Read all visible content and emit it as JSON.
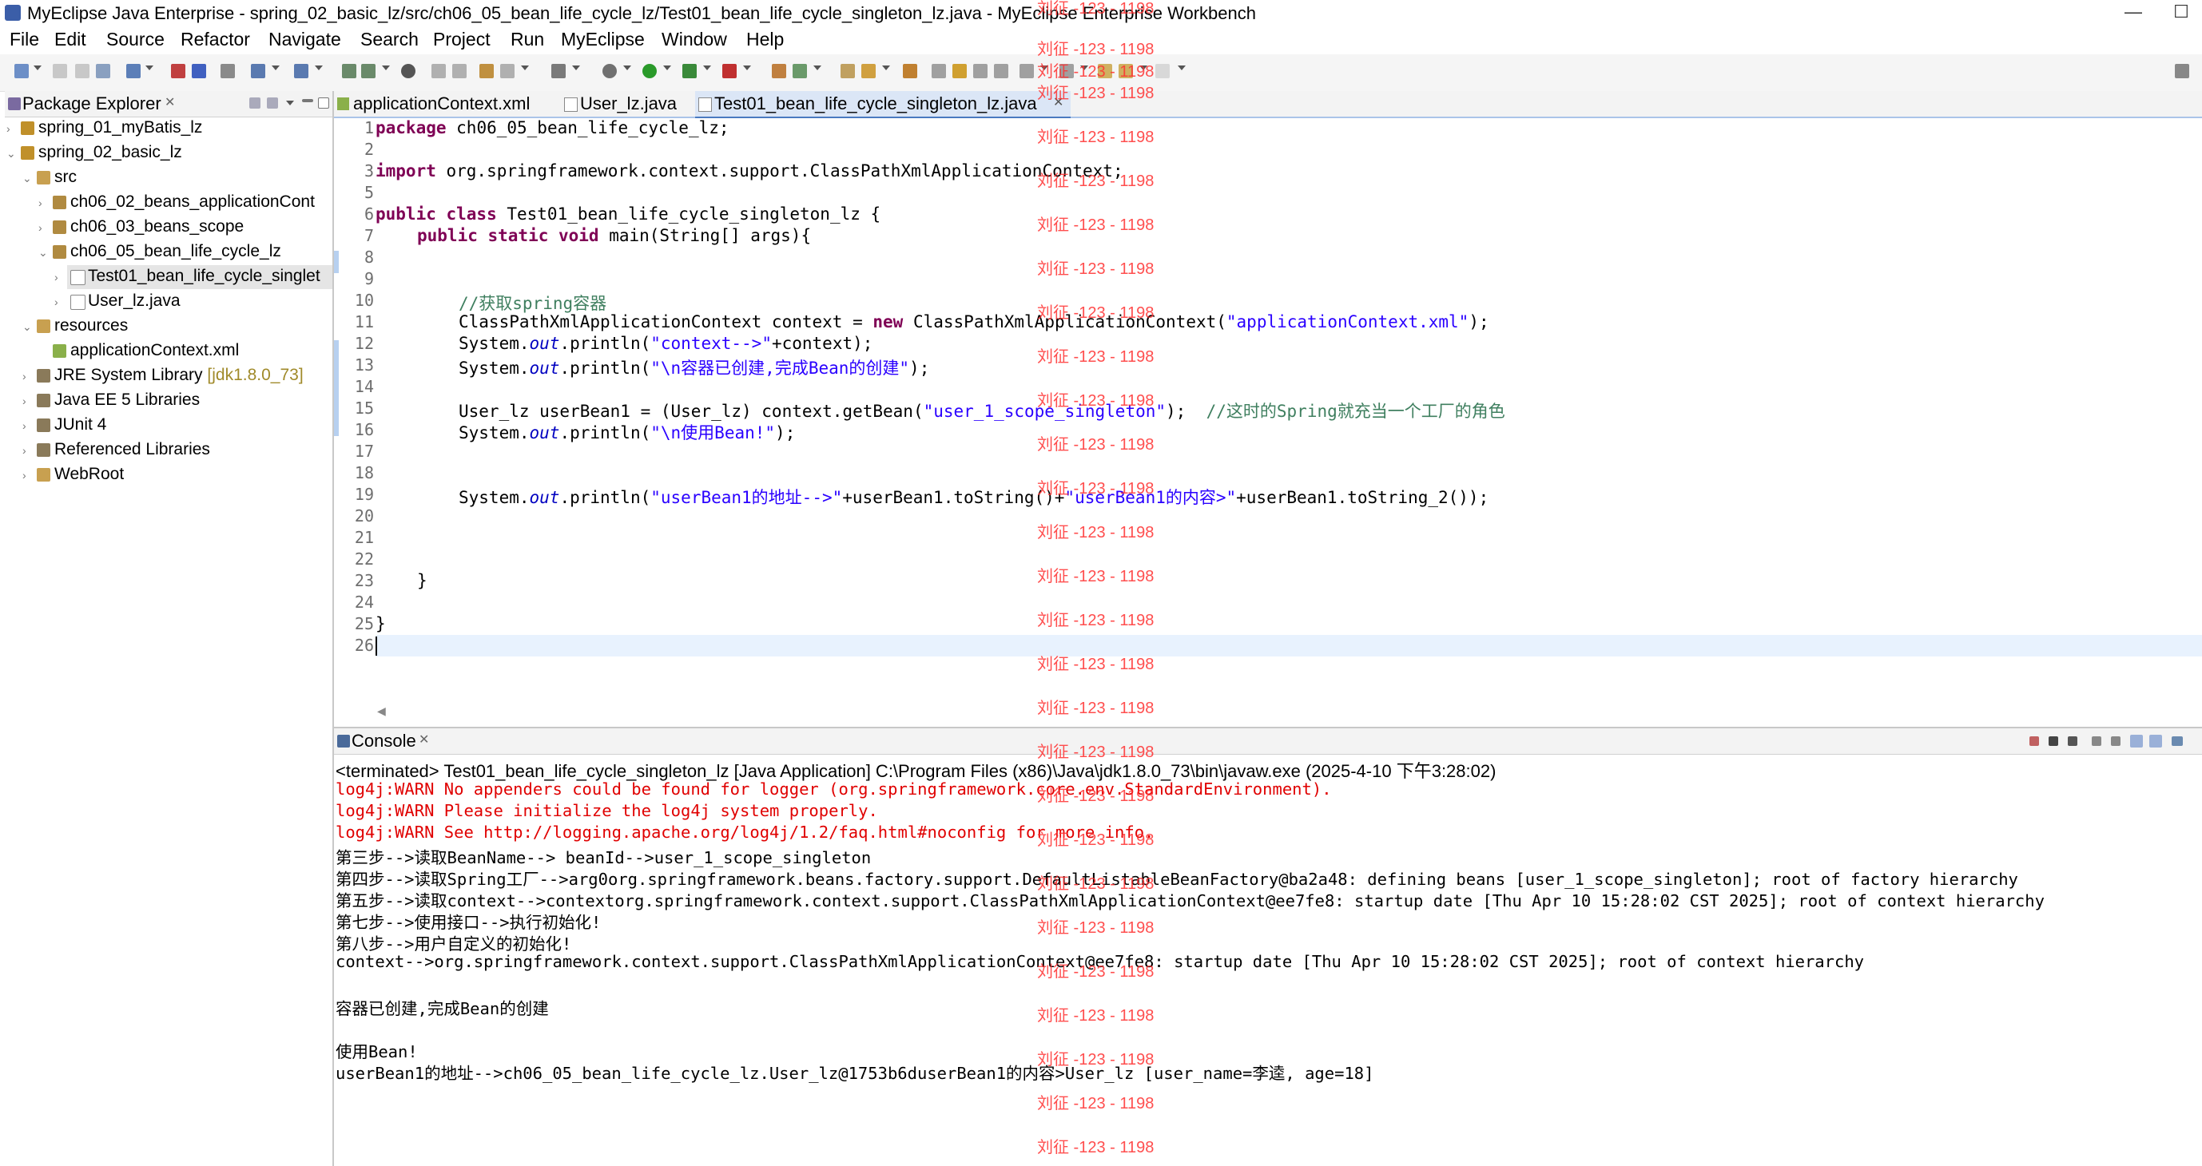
{
  "window": {
    "title": "MyEclipse Java Enterprise - spring_02_basic_lz/src/ch06_05_bean_life_cycle_lz/Test01_bean_life_cycle_singleton_lz.java - MyEclipse Enterprise Workbench",
    "minimize": "—",
    "maximize": "☐"
  },
  "menu": [
    "File",
    "Edit",
    "Source",
    "Refactor",
    "Navigate",
    "Search",
    "Project",
    "Run",
    "MyEclipse",
    "Window",
    "Help"
  ],
  "package_explorer": {
    "title": "Package Explorer",
    "items": [
      {
        "label": "spring_01_myBatis_lz",
        "decoration": ""
      },
      {
        "label": "spring_02_basic_lz",
        "decoration": ""
      },
      {
        "label": "src",
        "decoration": ""
      },
      {
        "label": "ch06_02_beans_applicationCont",
        "decoration": ""
      },
      {
        "label": "ch06_03_beans_scope",
        "decoration": ""
      },
      {
        "label": "ch06_05_bean_life_cycle_lz",
        "decoration": ""
      },
      {
        "label": "Test01_bean_life_cycle_singlet",
        "decoration": ""
      },
      {
        "label": "User_lz.java",
        "decoration": ""
      },
      {
        "label": "resources",
        "decoration": ""
      },
      {
        "label": "applicationContext.xml",
        "decoration": ""
      },
      {
        "label": "JRE System Library",
        "decoration": "[jdk1.8.0_73]"
      },
      {
        "label": "Java EE 5 Libraries",
        "decoration": ""
      },
      {
        "label": "JUnit 4",
        "decoration": ""
      },
      {
        "label": "Referenced Libraries",
        "decoration": ""
      },
      {
        "label": "WebRoot",
        "decoration": ""
      }
    ]
  },
  "editor": {
    "tabs": [
      "applicationContext.xml",
      "User_lz.java",
      "Test01_bean_life_cycle_singleton_lz.java"
    ],
    "active_tab": "Test01_bean_life_cycle_singleton_lz.java",
    "line_numbers": [
      "1",
      "2",
      "3",
      "5",
      "6",
      "7",
      "8",
      "9",
      "10",
      "11",
      "12",
      "13",
      "14",
      "15",
      "16",
      "17",
      "18",
      "19",
      "20",
      "21",
      "22",
      "23",
      "24",
      "25",
      "26"
    ],
    "code": {
      "l1_kw": "package",
      "l1_rest": " ch06_05_bean_life_cycle_lz;",
      "l3_kw": "import",
      "l3_rest": " org.springframework.context.support.ClassPathXmlApplicationContext;",
      "l6_kw": "public class",
      "l6_rest": " Test01_bean_life_cycle_singleton_lz {",
      "l7_kw": "public static void",
      "l7_rest": " main(String[] args){",
      "l10_cmt": "//获取spring容器",
      "l11_a": "ClassPathXmlApplicationContext context = ",
      "l11_kw": "new",
      "l11_b": " ClassPathXmlApplicationContext(",
      "l11_str": "\"applicationContext.xml\"",
      "l11_c": ");",
      "l12_a": "System.",
      "l12_fld": "out",
      "l12_b": ".println(",
      "l12_str": "\"context-->\"",
      "l12_c": "+context);",
      "l13_a": "System.",
      "l13_fld": "out",
      "l13_b": ".println(",
      "l13_str": "\"\\n容器已创建,完成Bean的创建\"",
      "l13_c": ");",
      "l15_a": "User_lz userBean1 = (User_lz) context.getBean(",
      "l15_str": "\"user_1_scope_singleton\"",
      "l15_b": ");  ",
      "l15_cmt": "//这时的Spring就充当一个工厂的角色",
      "l16_a": "System.",
      "l16_fld": "out",
      "l16_b": ".println(",
      "l16_str": "\"\\n使用Bean!\"",
      "l16_c": ");",
      "l19_a": "System.",
      "l19_fld": "out",
      "l19_b": ".println(",
      "l19_str1": "\"userBean1的地址-->\"",
      "l19_c": "+userBean1.toString()+",
      "l19_str2": "\"userBean1的内容>\"",
      "l19_d": "+userBean1.toString_2());",
      "l23": "}",
      "l25": "}"
    }
  },
  "console": {
    "title": "Console",
    "status": "<terminated> Test01_bean_life_cycle_singleton_lz [Java Application] C:\\Program Files (x86)\\Java\\jdk1.8.0_73\\bin\\javaw.exe (2025-4-10 下午3:28:02)",
    "lines": [
      {
        "text": "log4j:WARN No appenders could be found for logger (org.springframework.core.env.StandardEnvironment).",
        "kind": "err"
      },
      {
        "text": "log4j:WARN Please initialize the log4j system properly.",
        "kind": "err"
      },
      {
        "text": "log4j:WARN See http://logging.apache.org/log4j/1.2/faq.html#noconfig for more info.",
        "kind": "err"
      },
      {
        "text": "第三步-->读取BeanName--> beanId-->user_1_scope_singleton",
        "kind": "out"
      },
      {
        "text": "第四步-->读取Spring工厂-->arg0org.springframework.beans.factory.support.DefaultListableBeanFactory@ba2a48: defining beans [user_1_scope_singleton]; root of factory hierarchy",
        "kind": "out"
      },
      {
        "text": "第五步-->读取context-->contextorg.springframework.context.support.ClassPathXmlApplicationContext@ee7fe8: startup date [Thu Apr 10 15:28:02 CST 2025]; root of context hierarchy",
        "kind": "out"
      },
      {
        "text": "第七步-->使用接口-->执行初始化!",
        "kind": "out"
      },
      {
        "text": "第八步-->用户自定义的初始化!",
        "kind": "out"
      },
      {
        "text": "context-->org.springframework.context.support.ClassPathXmlApplicationContext@ee7fe8: startup date [Thu Apr 10 15:28:02 CST 2025]; root of context hierarchy",
        "kind": "out"
      },
      {
        "text": "",
        "kind": "out"
      },
      {
        "text": "容器已创建,完成Bean的创建",
        "kind": "out"
      },
      {
        "text": "",
        "kind": "out"
      },
      {
        "text": "使用Bean!",
        "kind": "out"
      },
      {
        "text": "userBean1的地址-->ch06_05_bean_life_cycle_lz.User_lz@1753b6duserBean1的内容>User_lz [user_name=李逵, age=18]",
        "kind": "out"
      }
    ]
  },
  "watermark": {
    "text": "刘征 -123 - 1198"
  }
}
